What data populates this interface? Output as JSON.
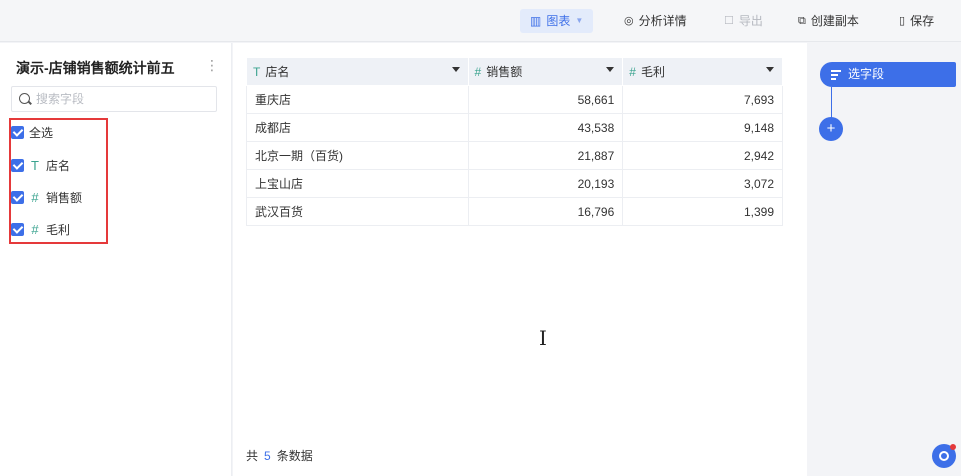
{
  "toolbar": {
    "chart_label": "图表",
    "analysis_label": "分析详情",
    "export_label": "导出",
    "copy_label": "创建副本",
    "save_label": "保存"
  },
  "sidebar": {
    "dataset_title": "演示-店铺销售额统计前五",
    "search_placeholder": "搜索字段",
    "select_all_label": "全选",
    "fields": [
      {
        "type_icon": "T",
        "label": "店名"
      },
      {
        "type_icon": "#",
        "label": "销售额"
      },
      {
        "type_icon": "#",
        "label": "毛利"
      }
    ]
  },
  "table": {
    "columns": [
      {
        "type_icon": "T",
        "label": "店名"
      },
      {
        "type_icon": "#",
        "label": "销售额"
      },
      {
        "type_icon": "#",
        "label": "毛利"
      }
    ],
    "rows": [
      [
        "重庆店",
        "58,661",
        "7,693"
      ],
      [
        "成都店",
        "43,538",
        "9,148"
      ],
      [
        "北京一期（百货)",
        "21,887",
        "2,942"
      ],
      [
        "上宝山店",
        "20,193",
        "3,072"
      ],
      [
        "武汉百货",
        "16,796",
        "1,399"
      ]
    ],
    "footer_prefix": "共",
    "row_count": "5",
    "footer_suffix": "条数据"
  },
  "right_panel": {
    "select_field_label": "选字段",
    "add_symbol": "+"
  },
  "colors": {
    "accent": "#3d6fe8",
    "highlight_border": "#e5393a",
    "field_type": "#3aa38f"
  }
}
